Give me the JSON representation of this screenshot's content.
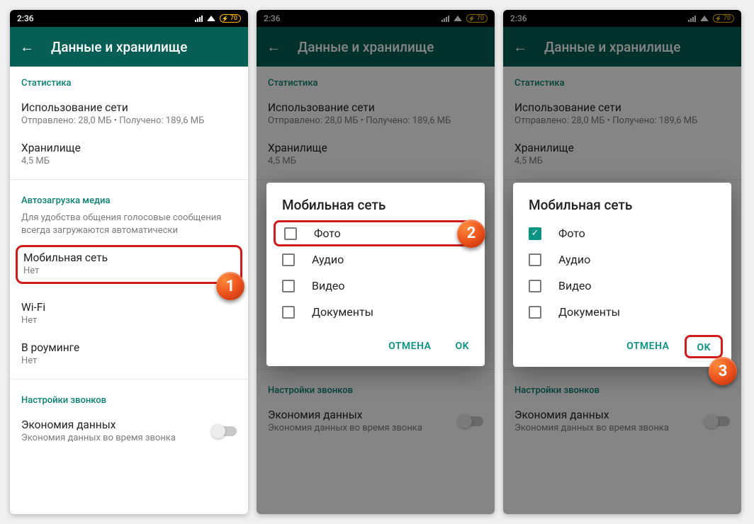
{
  "status": {
    "time": "2:36",
    "battery": "70"
  },
  "appbar": {
    "title": "Данные и хранилище"
  },
  "sections": {
    "stats": "Статистика",
    "autoload": "Автозагрузка медиа",
    "calls": "Настройки звонков"
  },
  "rows": {
    "network_usage": {
      "title": "Использование сети",
      "sub": "Отправлено: 28,0 МБ • Получено: 189,6 МБ"
    },
    "storage": {
      "title": "Хранилище",
      "sub": "4,5 МБ"
    },
    "mobile": {
      "title": "Мобильная сеть",
      "sub": "Нет"
    },
    "wifi": {
      "title": "Wi-Fi",
      "sub": "Нет"
    },
    "roaming": {
      "title": "В роуминге",
      "sub": "Нет"
    },
    "data_saver": {
      "title": "Экономия данных",
      "sub": "Экономия данных во время звонка"
    }
  },
  "help": "Для удобства общения голосовые сообщения всегда загружаются автоматически",
  "dialog": {
    "title": "Мобильная сеть",
    "options": {
      "photo": "Фото",
      "audio": "Аудио",
      "video": "Видео",
      "docs": "Документы"
    },
    "cancel": "ОТМЕНА",
    "ok": "OK"
  },
  "badges": {
    "s1": "1",
    "s2": "2",
    "s3": "3"
  }
}
